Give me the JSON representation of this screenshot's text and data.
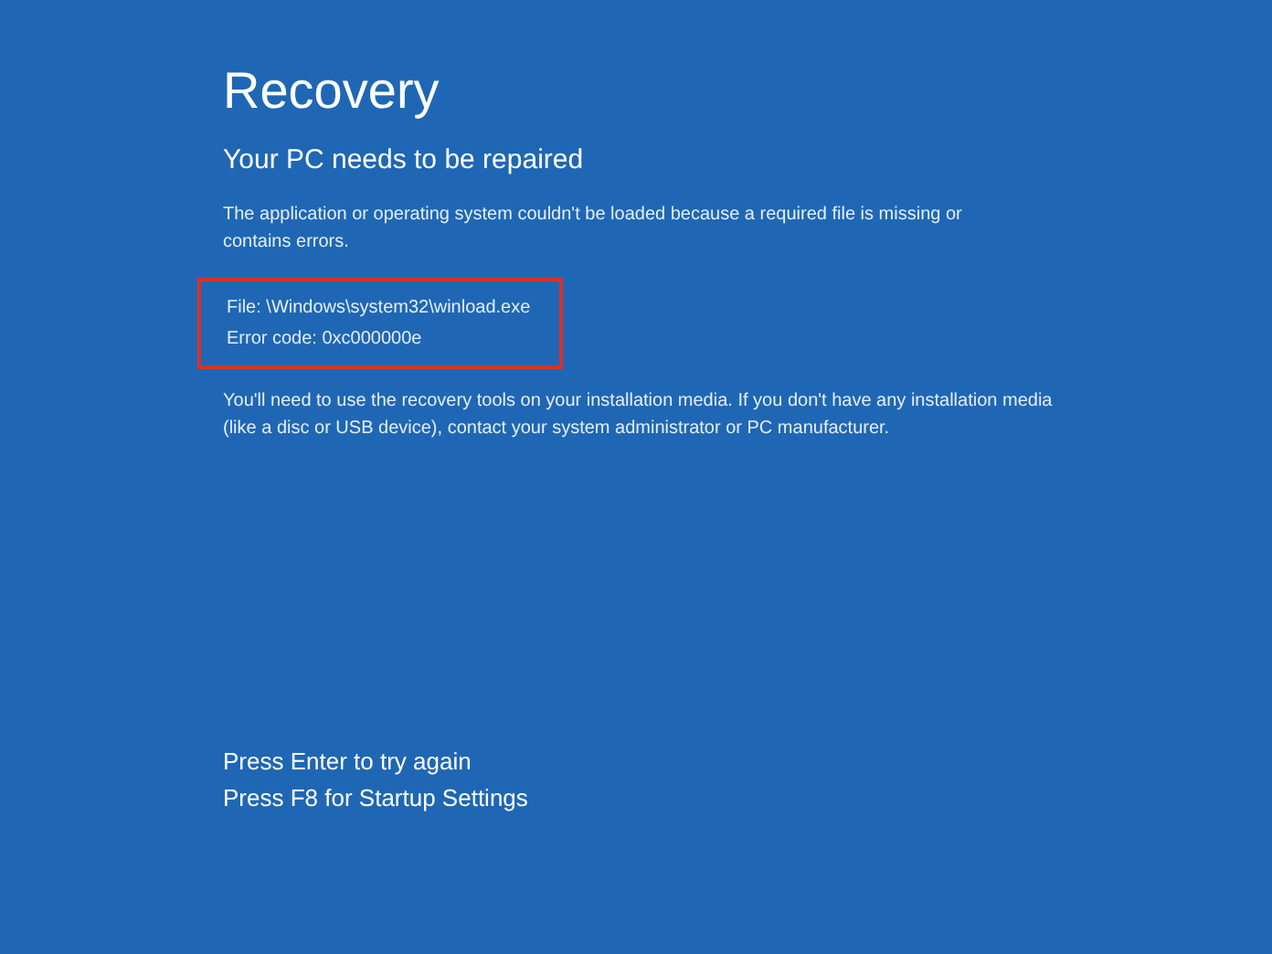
{
  "title": "Recovery",
  "subtitle": "Your PC needs to be repaired",
  "message": "The application or operating system couldn't be loaded because a required file is missing or contains errors.",
  "details": {
    "highlighted": true,
    "lines": [
      "File: \\Windows\\system32\\winload.exe",
      "Error code: 0xc000000e"
    ]
  },
  "advice": "You'll need to use the recovery tools on your installation media. If you don't have any installation media (like a disc or USB device), contact your system administrator or PC manufacturer.",
  "prompts": [
    "Press Enter to try again",
    "Press F8 for Startup Settings"
  ]
}
